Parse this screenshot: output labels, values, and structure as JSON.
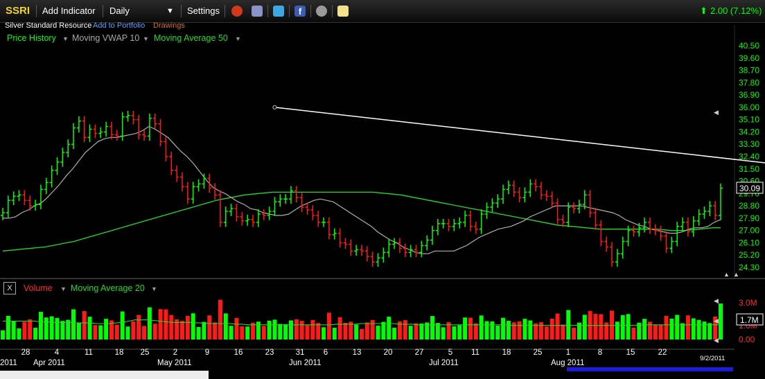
{
  "toolbar": {
    "ticker": "SSRI",
    "add_indicator": "Add Indicator",
    "period": "Daily",
    "settings": "Settings",
    "change": "2.00 (7.12%)",
    "icons": [
      "alarm-icon",
      "notes-icon",
      "twitter-icon",
      "facebook-icon",
      "binoculars-icon",
      "sticky-note-icon"
    ]
  },
  "subheader": {
    "company": "Silver Standard Resource",
    "add_portfolio": "Add to Portfolio",
    "drawings": "Drawings"
  },
  "indicators": {
    "price_history": "Price History",
    "vwap": "Moving VWAP 10",
    "ma50": "Moving Average 50"
  },
  "volume_panel": {
    "close": "X",
    "volume": "Volume",
    "ma20": "Moving Average 20"
  },
  "colors": {
    "up": "#00ff00",
    "down": "#ff1a1a",
    "ma50": "#22dd22",
    "vwap": "#b0b0b0",
    "trend": "#ffffff",
    "axis": "#00ff00",
    "background": "#000000"
  },
  "chart_data": [
    {
      "type": "ohlc",
      "ylim": [
        24.3,
        40.5
      ],
      "yticks": [
        "40.50",
        "39.60",
        "38.70",
        "37.80",
        "36.90",
        "36.00",
        "35.10",
        "34.20",
        "33.30",
        "32.40",
        "31.50",
        "30.60",
        "29.70",
        "28.80",
        "27.90",
        "27.00",
        "26.10",
        "25.20",
        "24.30"
      ],
      "last_price_label": "30.09",
      "xlabels_days": [
        "28",
        "4",
        "11",
        "18",
        "25",
        "2",
        "9",
        "16",
        "23",
        "31",
        "6",
        "13",
        "20",
        "27",
        "5",
        "11",
        "18",
        "25",
        "1",
        "8",
        "15",
        "22"
      ],
      "xlabels_months": [
        "2011",
        "Apr 2011",
        "May 2011",
        "Jun 2011",
        "Jul 2011",
        "Aug 2011"
      ],
      "date_stamp": "9/2/2011",
      "closes": [
        28.3,
        29.2,
        29.5,
        29.6,
        29.2,
        28.8,
        28.9,
        30,
        30.5,
        31.4,
        32,
        32.7,
        33.3,
        34.5,
        35,
        33.8,
        34.4,
        34.1,
        34.2,
        34.6,
        34,
        33.9,
        35.3,
        35.4,
        35.1,
        34,
        33.9,
        35.2,
        34.8,
        33.5,
        32.4,
        31.4,
        30.9,
        30.2,
        29.3,
        30.2,
        30.4,
        30.8,
        30.1,
        29.6,
        27.6,
        28.4,
        28.6,
        28,
        27.7,
        27.8,
        27.6,
        28.2,
        28.1,
        28.4,
        29.1,
        29.3,
        29.3,
        29.9,
        29.4,
        28.7,
        28.5,
        28.1,
        27.6,
        27.6,
        26.7,
        26.8,
        26.1,
        26,
        25.5,
        25.6,
        25.5,
        25.1,
        24.7,
        25,
        25.4,
        26,
        26.1,
        25.7,
        25.4,
        25.6,
        25.4,
        25.9,
        26.3,
        27,
        27.5,
        27.5,
        27.3,
        27.5,
        27.6,
        28.1,
        27.3,
        27.1,
        28.2,
        28.7,
        29,
        29.3,
        30,
        30.3,
        29.8,
        29.4,
        29.8,
        30.4,
        30.2,
        29.6,
        29.5,
        29,
        27.8,
        27.6,
        28.7,
        28.6,
        28.9,
        29.6,
        28.3,
        27.4,
        26.2,
        25.8,
        24.7,
        25.3,
        26.2,
        27,
        26.9,
        27.2,
        27.6,
        27.1,
        27,
        26.6,
        25.7,
        26.2,
        27.3,
        27.6,
        26.9,
        27.7,
        28.2,
        28.4,
        28.8,
        28.1,
        30.09
      ],
      "vwap10": [
        27.9,
        27.9,
        28,
        28.3,
        28.5,
        28.8,
        29,
        29.4,
        29.9,
        30.4,
        31,
        31.5,
        32.1,
        32.7,
        33.1,
        33.5,
        33.7,
        33.8,
        33.8,
        33.9,
        34,
        34.1,
        34.3,
        34.6,
        34.4,
        34.1,
        33.8,
        33.3,
        32.8,
        32.4,
        31.9,
        31.3,
        30.7,
        30.2,
        29.9,
        29.7,
        29.4,
        29.1,
        28.9,
        28.6,
        28.5,
        28.3,
        28.2,
        28.1,
        28.1,
        28.2,
        28.5,
        28.8,
        29,
        29.2,
        29.3,
        29.2,
        29.1,
        28.8,
        28.5,
        28.2,
        27.9,
        27.6,
        27.3,
        26.9,
        26.6,
        26.3,
        26.1,
        25.8,
        25.6,
        25.4,
        25.3,
        25.3,
        25.5,
        25.5,
        25.5,
        25.5,
        25.7,
        25.9,
        26.2,
        26.5,
        26.7,
        26.9,
        27.1,
        27.2,
        27.3,
        27.5,
        27.7,
        28,
        28.2,
        28.4,
        28.6,
        28.8,
        28.8,
        28.8,
        28.8,
        28.8,
        28.7,
        28.6,
        28.5,
        28.4,
        28.3,
        28.1,
        27.8,
        27.6,
        27.4,
        27.3,
        27.1,
        27,
        26.9,
        26.8,
        26.8,
        26.9,
        27.1,
        27.2,
        27.2,
        27.3,
        27.6,
        27.8
      ],
      "ma50": [
        25.5,
        25.55,
        25.6,
        25.65,
        25.7,
        25.75,
        25.8,
        25.9,
        26,
        26.1,
        26.2,
        26.35,
        26.5,
        26.65,
        26.8,
        26.95,
        27.1,
        27.25,
        27.4,
        27.55,
        27.7,
        27.85,
        28,
        28.15,
        28.3,
        28.45,
        28.6,
        28.75,
        28.9,
        29.05,
        29.2,
        29.3,
        29.4,
        29.5,
        29.6,
        29.65,
        29.7,
        29.75,
        29.8,
        29.8,
        29.8,
        29.8,
        29.8,
        29.8,
        29.8,
        29.8,
        29.8,
        29.8,
        29.8,
        29.8,
        29.8,
        29.8,
        29.8,
        29.75,
        29.7,
        29.65,
        29.6,
        29.5,
        29.4,
        29.3,
        29.2,
        29.1,
        29,
        28.9,
        28.8,
        28.7,
        28.6,
        28.5,
        28.4,
        28.3,
        28.2,
        28.1,
        28,
        27.9,
        27.8,
        27.7,
        27.6,
        27.5,
        27.4,
        27.35,
        27.3,
        27.25,
        27.2,
        27.15,
        27.1,
        27.1,
        27.1,
        27.1,
        27.1,
        27.1,
        27.1,
        27.1,
        27.1,
        27.05,
        27,
        27,
        27,
        27.05,
        27.1,
        27.15,
        27.2,
        27.2
      ],
      "trendline": {
        "x0": 50,
        "y0": 36.0,
        "x1": 230,
        "y1": 27.9
      }
    },
    {
      "type": "bar",
      "unit": "shares",
      "ylim": [
        0,
        4.0
      ],
      "yticks": [
        "3.0M",
        "1.0M",
        "0.00"
      ],
      "last_volume_label": "1.7M",
      "ma20": [
        1.5,
        1.5,
        1.5,
        1.5,
        1.5,
        1.5,
        1.45,
        1.45,
        1.4,
        1.4,
        1.4,
        1.4,
        1.35,
        1.35,
        1.35,
        1.3,
        1.3,
        1.3,
        1.35,
        1.4,
        1.5,
        1.6,
        1.6,
        1.6,
        1.55,
        1.5,
        1.45,
        1.4,
        1.4,
        1.4,
        1.4,
        1.35,
        1.35,
        1.3,
        1.3,
        1.3,
        1.3,
        1.25,
        1.25,
        1.2,
        1.2,
        1.2,
        1.2,
        1.2,
        1.2,
        1.2,
        1.2,
        1.2,
        1.2,
        1.2,
        1.2,
        1.2,
        1.2,
        1.25,
        1.25,
        1.25,
        1.25,
        1.3,
        1.3,
        1.3,
        1.3,
        1.3,
        1.3,
        1.25,
        1.25,
        1.25,
        1.2,
        1.2,
        1.2,
        1.2,
        1.2,
        1.2,
        1.2,
        1.2,
        1.2,
        1.2,
        1.2,
        1.2,
        1.2,
        1.2,
        1.2,
        1.15,
        1.15,
        1.15,
        1.15,
        1.15,
        1.15,
        1.15,
        1.15,
        1.15,
        1.15,
        1.15,
        1.15,
        1.15,
        1.15,
        1.15,
        1.15,
        1.15,
        1.15,
        1.15,
        1.15,
        1.15,
        1.2,
        1.2,
        1.2,
        1.2,
        1.2,
        1.2,
        1.2,
        1.2,
        1.2,
        1.2,
        1.2,
        1.2,
        1.2
      ]
    }
  ]
}
